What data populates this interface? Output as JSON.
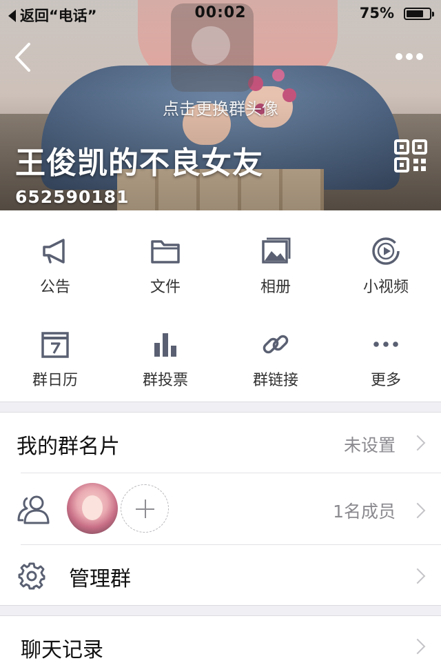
{
  "status_bar": {
    "back_label": "返回“电话”",
    "time": "00:02",
    "battery_percent": "75%",
    "battery_level": 0.75
  },
  "header": {
    "change_avatar_hint": "点击更换群头像",
    "group_name": "王俊凯的不良女友",
    "group_id": "652590181",
    "icons": [
      "back-chevron-icon",
      "more-dots-icon",
      "qr-code-icon"
    ]
  },
  "actions": [
    {
      "label": "公告",
      "icon": "megaphone-icon"
    },
    {
      "label": "文件",
      "icon": "folder-icon"
    },
    {
      "label": "相册",
      "icon": "photo-album-icon"
    },
    {
      "label": "小视频",
      "icon": "video-play-icon"
    },
    {
      "label": "群日历",
      "icon": "calendar-icon"
    },
    {
      "label": "群投票",
      "icon": "bar-chart-icon"
    },
    {
      "label": "群链接",
      "icon": "link-icon"
    },
    {
      "label": "更多",
      "icon": "more-horizontal-icon"
    }
  ],
  "settings": {
    "group_card": {
      "title": "我的群名片",
      "value": "未设置"
    },
    "members": {
      "count_text": "1名成员",
      "icon": "members-icon"
    },
    "manage": {
      "title": "管理群",
      "icon": "gear-icon"
    },
    "chat_history": {
      "title": "聊天记录"
    }
  },
  "colors": {
    "icon": "#5a6072",
    "secondary_text": "#8a8a8f",
    "separator_bg": "#efeff4"
  }
}
